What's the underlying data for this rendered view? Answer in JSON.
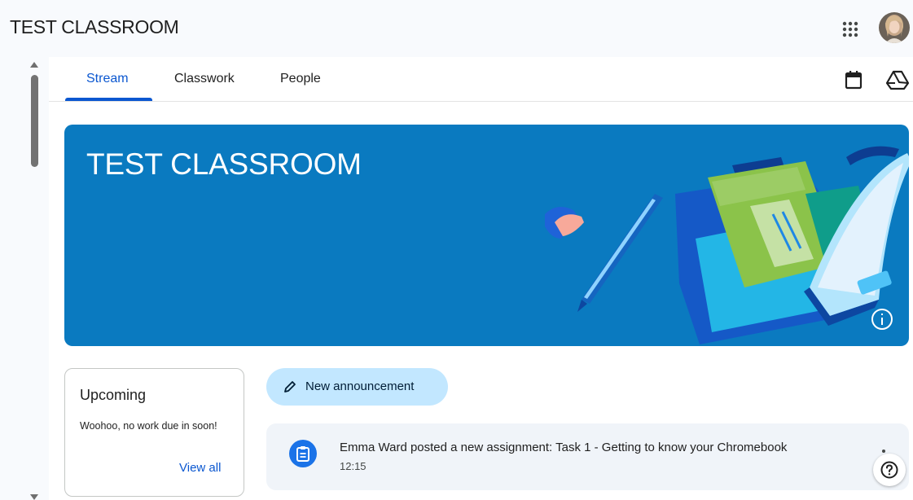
{
  "header": {
    "title": "TEST CLASSROOM",
    "apps_icon": "grid-dots-icon",
    "avatar_icon": "user-avatar"
  },
  "tabs": [
    {
      "label": "Stream",
      "active": true
    },
    {
      "label": "Classwork",
      "active": false
    },
    {
      "label": "People",
      "active": false
    }
  ],
  "toolbar": {
    "calendar_icon": "calendar-icon",
    "drive_icon": "google-drive-icon"
  },
  "banner": {
    "title": "TEST CLASSROOM",
    "background_color": "#0a7ac0",
    "info_icon": "info-icon"
  },
  "upcoming": {
    "title": "Upcoming",
    "message": "Woohoo, no work due in soon!",
    "view_all_label": "View all"
  },
  "announce": {
    "label": "New announcement",
    "icon": "pencil-icon"
  },
  "stream_posts": [
    {
      "text": "Emma Ward posted a new assignment: Task 1 - Getting to know your Chromebook",
      "time": "12:15",
      "icon": "assignment-icon"
    }
  ],
  "help": {
    "icon": "help-icon"
  },
  "colors": {
    "accent": "#0b57d0",
    "announce_bg": "#c2e7ff",
    "card_bg": "#f0f4f9"
  }
}
